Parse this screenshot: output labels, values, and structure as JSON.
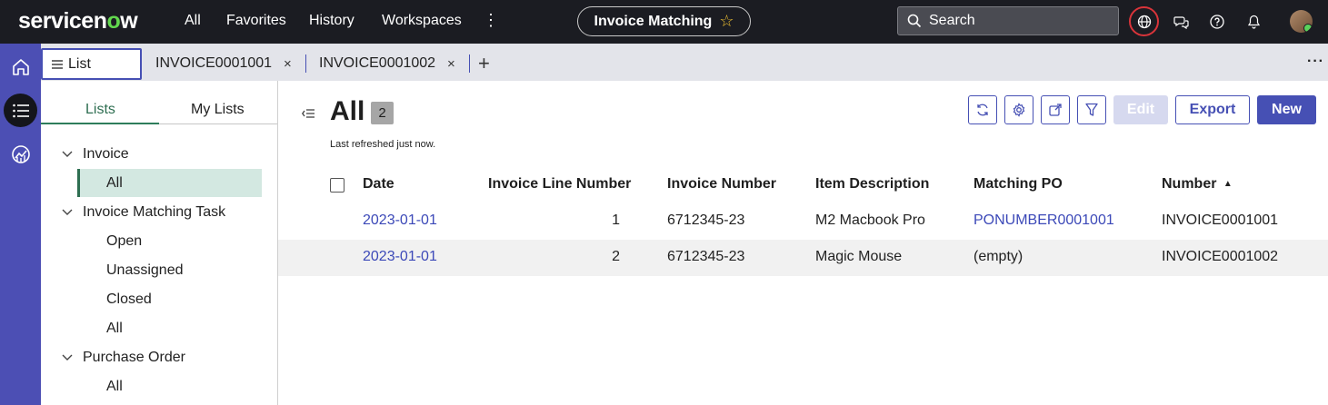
{
  "topnav": {
    "logo_prefix": "servicen",
    "logo_o": "o",
    "logo_suffix": "w",
    "links": [
      "All",
      "Favorites",
      "History",
      "Workspaces"
    ],
    "more": "⋮",
    "context_pill": "Invoice Matching",
    "search_label": "Search"
  },
  "tabs": {
    "list_label": "List",
    "open": [
      {
        "label": "INVOICE0001001",
        "close": "×"
      },
      {
        "label": "INVOICE0001002",
        "close": "×"
      }
    ],
    "add": "+",
    "more": "···"
  },
  "lists_panel": {
    "tab_lists": "Lists",
    "tab_my_lists": "My Lists",
    "groups": [
      {
        "label": "Invoice",
        "items": [
          "All"
        ]
      },
      {
        "label": "Invoice Matching Task",
        "items": [
          "Open",
          "Unassigned",
          "Closed",
          "All"
        ]
      },
      {
        "label": "Purchase Order",
        "items": [
          "All"
        ]
      }
    ]
  },
  "main": {
    "title": "All",
    "count": "2",
    "refreshed": "Last refreshed just now.",
    "buttons": {
      "edit": "Edit",
      "export": "Export",
      "new": "New"
    },
    "columns": [
      "Date",
      "Invoice Line Number",
      "Invoice Number",
      "Item Description",
      "Matching PO",
      "Number"
    ],
    "sort_indicator": "▲",
    "rows": [
      {
        "date": "2023-01-01",
        "line": "1",
        "invoice": "6712345-23",
        "item": "M2 Macbook Pro",
        "po": "PONUMBER0001001",
        "number": "INVOICE0001001"
      },
      {
        "date": "2023-01-01",
        "line": "2",
        "invoice": "6712345-23",
        "item": "Magic Mouse",
        "po": "(empty)",
        "number": "INVOICE0001002"
      }
    ]
  },
  "colors": {
    "topnav_bg": "#1b1c22",
    "rail_bg": "#4c4fb4",
    "accent": "#4650b4",
    "link": "#3c49b8",
    "selected_green": "#2e6e51",
    "logo_green": "#62d84e"
  }
}
